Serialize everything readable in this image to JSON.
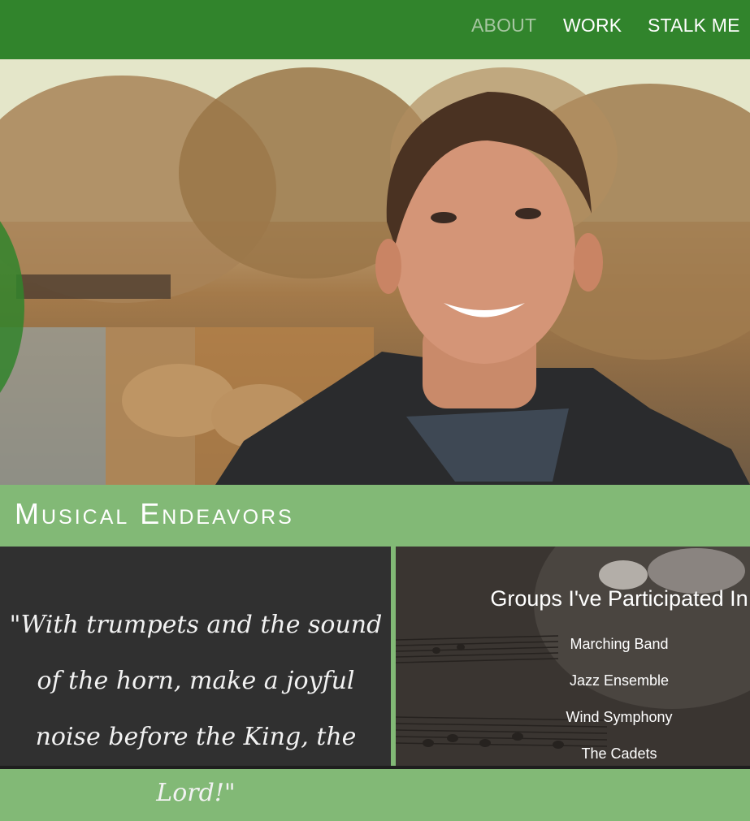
{
  "nav": {
    "items": [
      {
        "label": "ABOUT",
        "active": true
      },
      {
        "label": "WORK",
        "active": false
      },
      {
        "label": "STALK ME",
        "active": false
      }
    ]
  },
  "section": {
    "title": "Musical Endeavors"
  },
  "quote": {
    "text": "\"With trumpets and the sound of the horn, make a joyful noise before the King, the Lord!\""
  },
  "groups": {
    "title": "Groups I've Participated In",
    "items": [
      "Marching Band",
      "Jazz Ensemble",
      "Wind Symphony",
      "The Cadets"
    ]
  },
  "colors": {
    "nav_green": "#31842c",
    "section_green": "#82b976",
    "quote_panel": "#303030",
    "nav_active": "#a6c6a1"
  },
  "images": {
    "hero": "portrait-photo-outdoors",
    "groups_bg": "sheet-music-and-brass-instrument"
  }
}
